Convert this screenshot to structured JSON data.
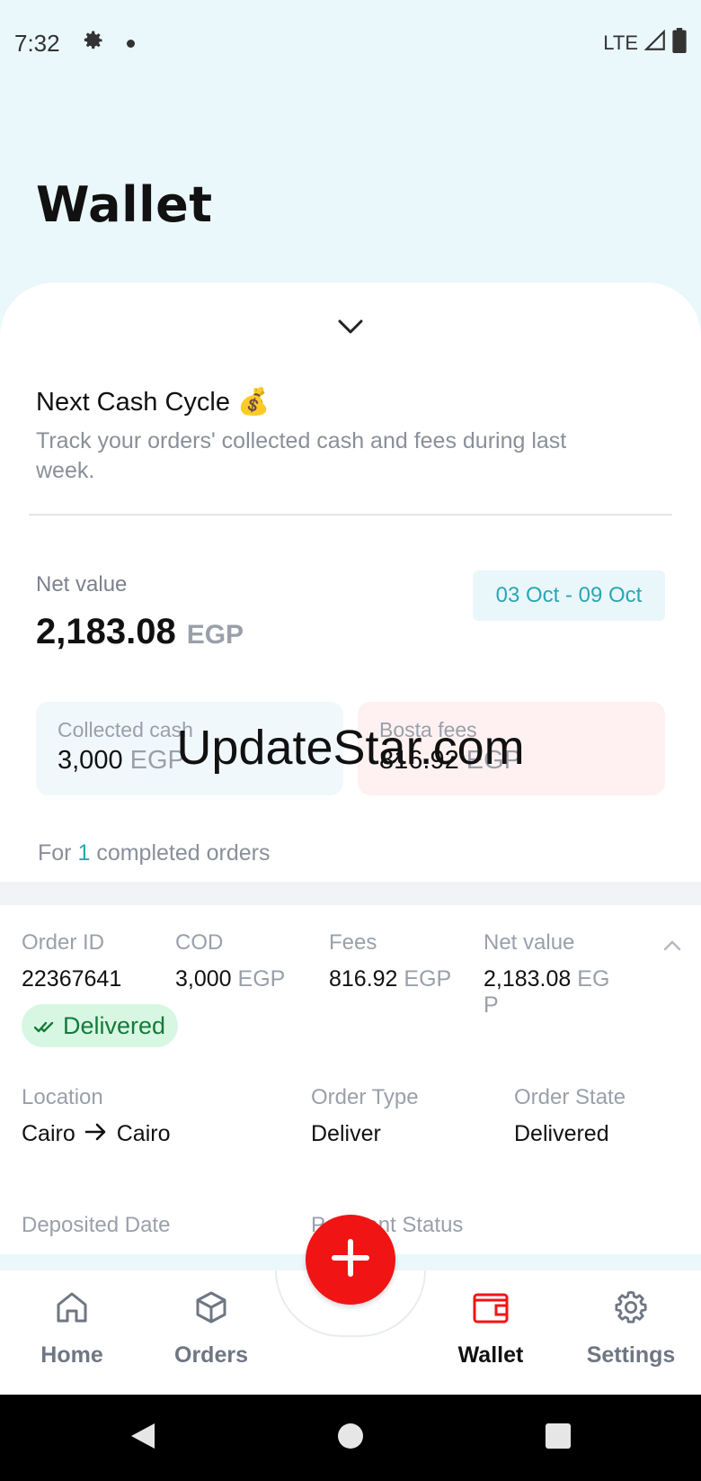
{
  "status_bar": {
    "time": "7:32",
    "network": "LTE"
  },
  "page": {
    "title": "Wallet"
  },
  "cycle": {
    "title": "Next Cash Cycle 💰",
    "subtitle": "Track your orders' collected cash and fees during last week.",
    "net_value_label": "Net value",
    "net_value": "2,183.08",
    "currency": "EGP",
    "date_range": "03 Oct - 09 Oct",
    "collected_cash_label": "Collected cash",
    "collected_cash": "3,000",
    "bosta_fees_label": "Bosta fees",
    "bosta_fees": "816.92",
    "orders_prefix": "For",
    "orders_count": "1",
    "orders_suffix": "completed orders"
  },
  "watermark": "UpdateStar.com",
  "order": {
    "order_id_label": "Order ID",
    "order_id": "22367641",
    "cod_label": "COD",
    "cod": "3,000",
    "fees_label": "Fees",
    "fees": "816.92",
    "net_value_label": "Net value",
    "net_value": "2,183.08",
    "currency": "EGP",
    "status": "Delivered",
    "location_label": "Location",
    "location_from": "Cairo",
    "location_to": "Cairo",
    "order_type_label": "Order Type",
    "order_type": "Deliver",
    "order_state_label": "Order State",
    "order_state": "Delivered",
    "deposited_date_label": "Deposited Date",
    "payment_status_label": "Payment Status"
  },
  "nav": {
    "home": "Home",
    "orders": "Orders",
    "wallet": "Wallet",
    "settings": "Settings"
  },
  "colors": {
    "accent": "#f01414",
    "teal": "#2aa6b5",
    "success": "#157a3a"
  }
}
